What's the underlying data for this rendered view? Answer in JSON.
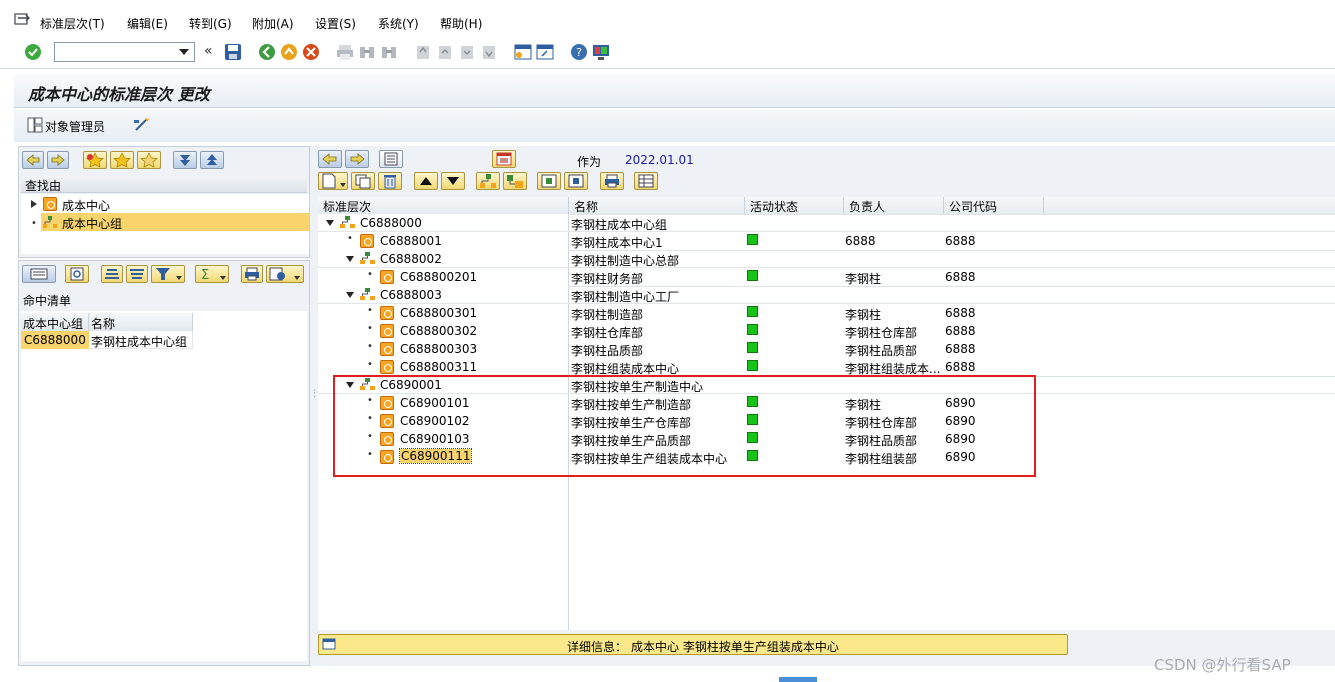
{
  "menu": {
    "items": [
      "标准层次(T)",
      "编辑(E)",
      "转到(G)",
      "附加(A)",
      "设置(S)",
      "系统(Y)",
      "帮助(H)"
    ]
  },
  "toolbar": {
    "command_field_value": "",
    "back_label": "«"
  },
  "title": "成本中心的标准层次 更改",
  "app_toolbar": {
    "object_manager_label": "对象管理员"
  },
  "left": {
    "search_by_label": "查找由",
    "search_options": [
      "成本中心",
      "成本中心组"
    ],
    "hit_list_label": "命中清单",
    "hit_columns": [
      "成本中心组",
      "名称"
    ],
    "hit_rows": [
      {
        "group": "C6888000",
        "name": "李钢柱成本中心组"
      }
    ]
  },
  "right": {
    "as_of_label": "作为",
    "as_of_date": "2022.01.01",
    "columns": [
      "标准层次",
      "名称",
      "活动状态",
      "负责人",
      "公司代码"
    ],
    "rows": [
      {
        "id": "C6888000",
        "name": "李钢柱成本中心组",
        "type": "group",
        "level": 0,
        "expanded": true
      },
      {
        "id": "C6888001",
        "name": "李钢柱成本中心1",
        "type": "cc",
        "level": 1,
        "active": true,
        "owner": "6888",
        "company": "6888"
      },
      {
        "id": "C6888002",
        "name": "李钢柱制造中心总部",
        "type": "group",
        "level": 1,
        "expanded": true
      },
      {
        "id": "C688800201",
        "name": "李钢柱财务部",
        "type": "cc",
        "level": 2,
        "active": true,
        "owner": "李钢柱",
        "company": "6888"
      },
      {
        "id": "C6888003",
        "name": "李钢柱制造中心工厂",
        "type": "group",
        "level": 1,
        "expanded": true
      },
      {
        "id": "C688800301",
        "name": "李钢柱制造部",
        "type": "cc",
        "level": 2,
        "active": true,
        "owner": "李钢柱",
        "company": "6888"
      },
      {
        "id": "C688800302",
        "name": "李钢柱仓库部",
        "type": "cc",
        "level": 2,
        "active": true,
        "owner": "李钢柱仓库部",
        "company": "6888"
      },
      {
        "id": "C688800303",
        "name": "李钢柱品质部",
        "type": "cc",
        "level": 2,
        "active": true,
        "owner": "李钢柱品质部",
        "company": "6888"
      },
      {
        "id": "C688800311",
        "name": "李钢柱组装成本中心",
        "type": "cc",
        "level": 2,
        "active": true,
        "owner": "李钢柱组装成本...",
        "company": "6888"
      },
      {
        "id": "C6890001",
        "name": "李钢柱按单生产制造中心",
        "type": "group",
        "level": 1,
        "expanded": true
      },
      {
        "id": "C68900101",
        "name": "李钢柱按单生产制造部",
        "type": "cc",
        "level": 2,
        "active": true,
        "owner": "李钢柱",
        "company": "6890"
      },
      {
        "id": "C68900102",
        "name": "李钢柱按单生产仓库部",
        "type": "cc",
        "level": 2,
        "active": true,
        "owner": "李钢柱仓库部",
        "company": "6890"
      },
      {
        "id": "C68900103",
        "name": "李钢柱按单生产品质部",
        "type": "cc",
        "level": 2,
        "active": true,
        "owner": "李钢柱品质部",
        "company": "6890"
      },
      {
        "id": "C68900111",
        "name": "李钢柱按单生产组装成本中心",
        "type": "cc",
        "level": 2,
        "active": true,
        "owner": "李钢柱组装部",
        "company": "6890",
        "selected": true
      }
    ],
    "detail_label": "详细信息：",
    "detail_text": "成本中心 李钢柱按单生产组装成本中心"
  },
  "watermark": "CSDN @外行看SAP",
  "colors": {
    "highlight": "#f9d36b",
    "status_green": "#19c219",
    "annotation_red": "#e02020"
  }
}
